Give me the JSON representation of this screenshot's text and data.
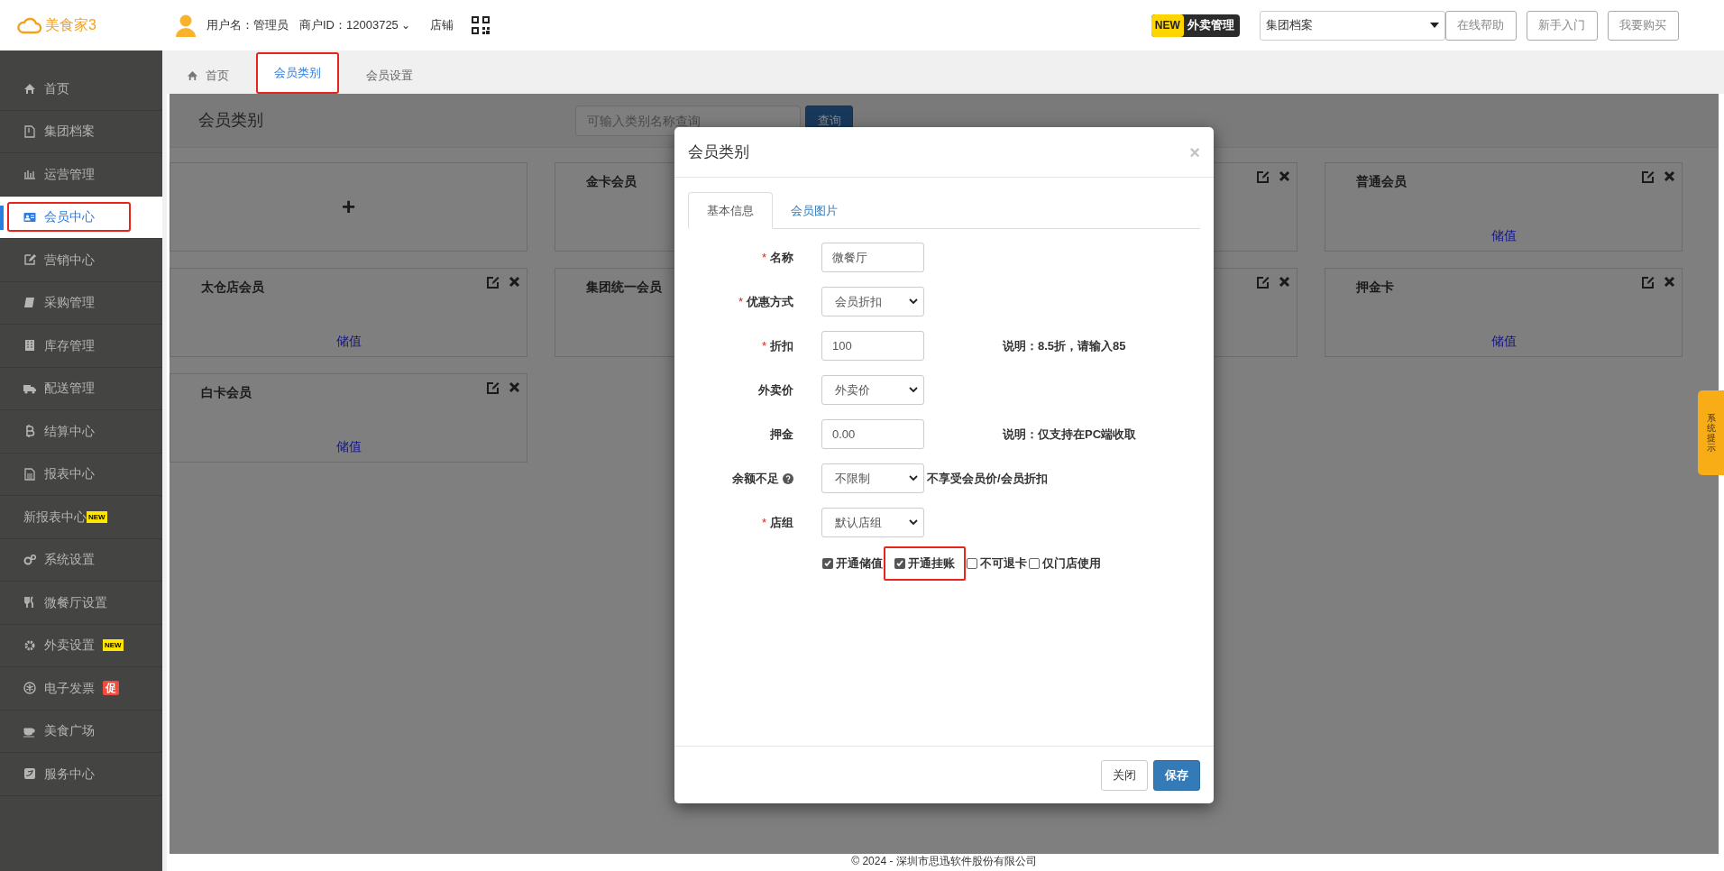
{
  "header": {
    "logo": "美食家3",
    "user": "用户名：管理员",
    "merchant": "商户ID：12003725",
    "merchant_caret": "⌄",
    "store": "店铺",
    "promo_badge": "NEW",
    "promo_label": "外卖管理",
    "group_select": "集团档案",
    "buttons": [
      "在线帮助",
      "新手入门",
      "我要购买"
    ]
  },
  "sidebar": {
    "items": [
      {
        "label": "首页",
        "selected": false,
        "highlighted": false
      },
      {
        "label": "集团档案",
        "selected": false,
        "highlighted": false
      },
      {
        "label": "运营管理",
        "selected": false,
        "highlighted": false
      },
      {
        "label": "会员中心",
        "selected": true,
        "highlighted": true
      },
      {
        "label": "营销中心",
        "selected": false,
        "highlighted": false
      },
      {
        "label": "采购管理",
        "selected": false,
        "highlighted": false
      },
      {
        "label": "库存管理",
        "selected": false,
        "highlighted": false
      },
      {
        "label": "配送管理",
        "selected": false,
        "highlighted": false
      },
      {
        "label": "结算中心",
        "selected": false,
        "highlighted": false
      },
      {
        "label": "报表中心",
        "selected": false,
        "highlighted": false
      },
      {
        "label": "新报表中心",
        "selected": false,
        "highlighted": false,
        "badge": {
          "text": "NEW",
          "kind": "new"
        }
      },
      {
        "label": "系统设置",
        "selected": false,
        "highlighted": false
      },
      {
        "label": "微餐厅设置",
        "selected": false,
        "highlighted": false
      },
      {
        "label": "外卖设置",
        "selected": false,
        "highlighted": false,
        "badge": {
          "text": "NEW",
          "kind": "new"
        }
      },
      {
        "label": "电子发票",
        "selected": false,
        "highlighted": false,
        "badge": {
          "text": "促",
          "kind": "promo"
        }
      },
      {
        "label": "美食广场",
        "selected": false,
        "highlighted": false
      },
      {
        "label": "服务中心",
        "selected": false,
        "highlighted": false
      }
    ]
  },
  "tabs": [
    {
      "label": "首页",
      "selected": false,
      "highlighted": false
    },
    {
      "label": "会员类别",
      "selected": true,
      "highlighted": true
    },
    {
      "label": "会员设置",
      "selected": false,
      "highlighted": false
    }
  ],
  "panel": {
    "title": "会员类别",
    "search_placeholder": "可输入类别名称查询",
    "search_button": "查询",
    "cards": [
      {
        "kind": "add",
        "label": "+"
      },
      {
        "kind": "category",
        "name": "金卡会员",
        "actions": false
      },
      {
        "kind": "category",
        "actions": true
      },
      {
        "kind": "category",
        "name": "普通会员",
        "actions": true,
        "link": "储值"
      },
      {
        "kind": "category",
        "name": "太仓店会员",
        "actions": true,
        "link": "储值"
      },
      {
        "kind": "category",
        "name": "集团统一会员",
        "actions": false
      },
      {
        "kind": "category",
        "actions": true
      },
      {
        "kind": "category",
        "name": "押金卡",
        "actions": true,
        "link": "储值"
      },
      {
        "kind": "category",
        "name": "白卡会员",
        "actions": true,
        "link": "储值"
      }
    ]
  },
  "modal": {
    "title": "会员类别",
    "close": "×",
    "tabs": [
      {
        "label": "基本信息",
        "selected": true
      },
      {
        "label": "会员图片",
        "selected": false
      }
    ],
    "fields": [
      {
        "label": "名称",
        "required_mark": "*",
        "kind": "input",
        "value": "微餐厅"
      },
      {
        "label": "优惠方式",
        "required_mark": "*",
        "kind": "select",
        "value": "会员折扣"
      },
      {
        "label": "折扣",
        "required_mark": "*",
        "kind": "input",
        "value": "100",
        "note": "说明：8.5折，请输入85"
      },
      {
        "label": "外卖价",
        "kind": "select",
        "value": "外卖价"
      },
      {
        "label": "押金",
        "kind": "input",
        "value": "0.00",
        "note": "说明：仅支持在PC端收取"
      },
      {
        "label": "余额不足",
        "kind": "select",
        "value": "不限制",
        "help": true,
        "suffix": "不享受会员价/会员折扣"
      },
      {
        "label": "店组",
        "required_mark": "*",
        "kind": "select",
        "value": "默认店组"
      }
    ],
    "checkboxes": [
      {
        "label": "开通储值",
        "checked": true,
        "highlighted": false
      },
      {
        "label": "开通挂账",
        "checked": true,
        "highlighted": true
      },
      {
        "label": "不可退卡",
        "checked": false,
        "highlighted": false
      },
      {
        "label": "仅门店使用",
        "checked": false,
        "highlighted": false
      }
    ],
    "buttons": [
      {
        "label": "关闭",
        "kind": "default"
      },
      {
        "label": "保存",
        "kind": "primary"
      }
    ]
  },
  "side_tab": "系统提示",
  "footer": "© 2024 - 深圳市思迅软件股份有限公司"
}
